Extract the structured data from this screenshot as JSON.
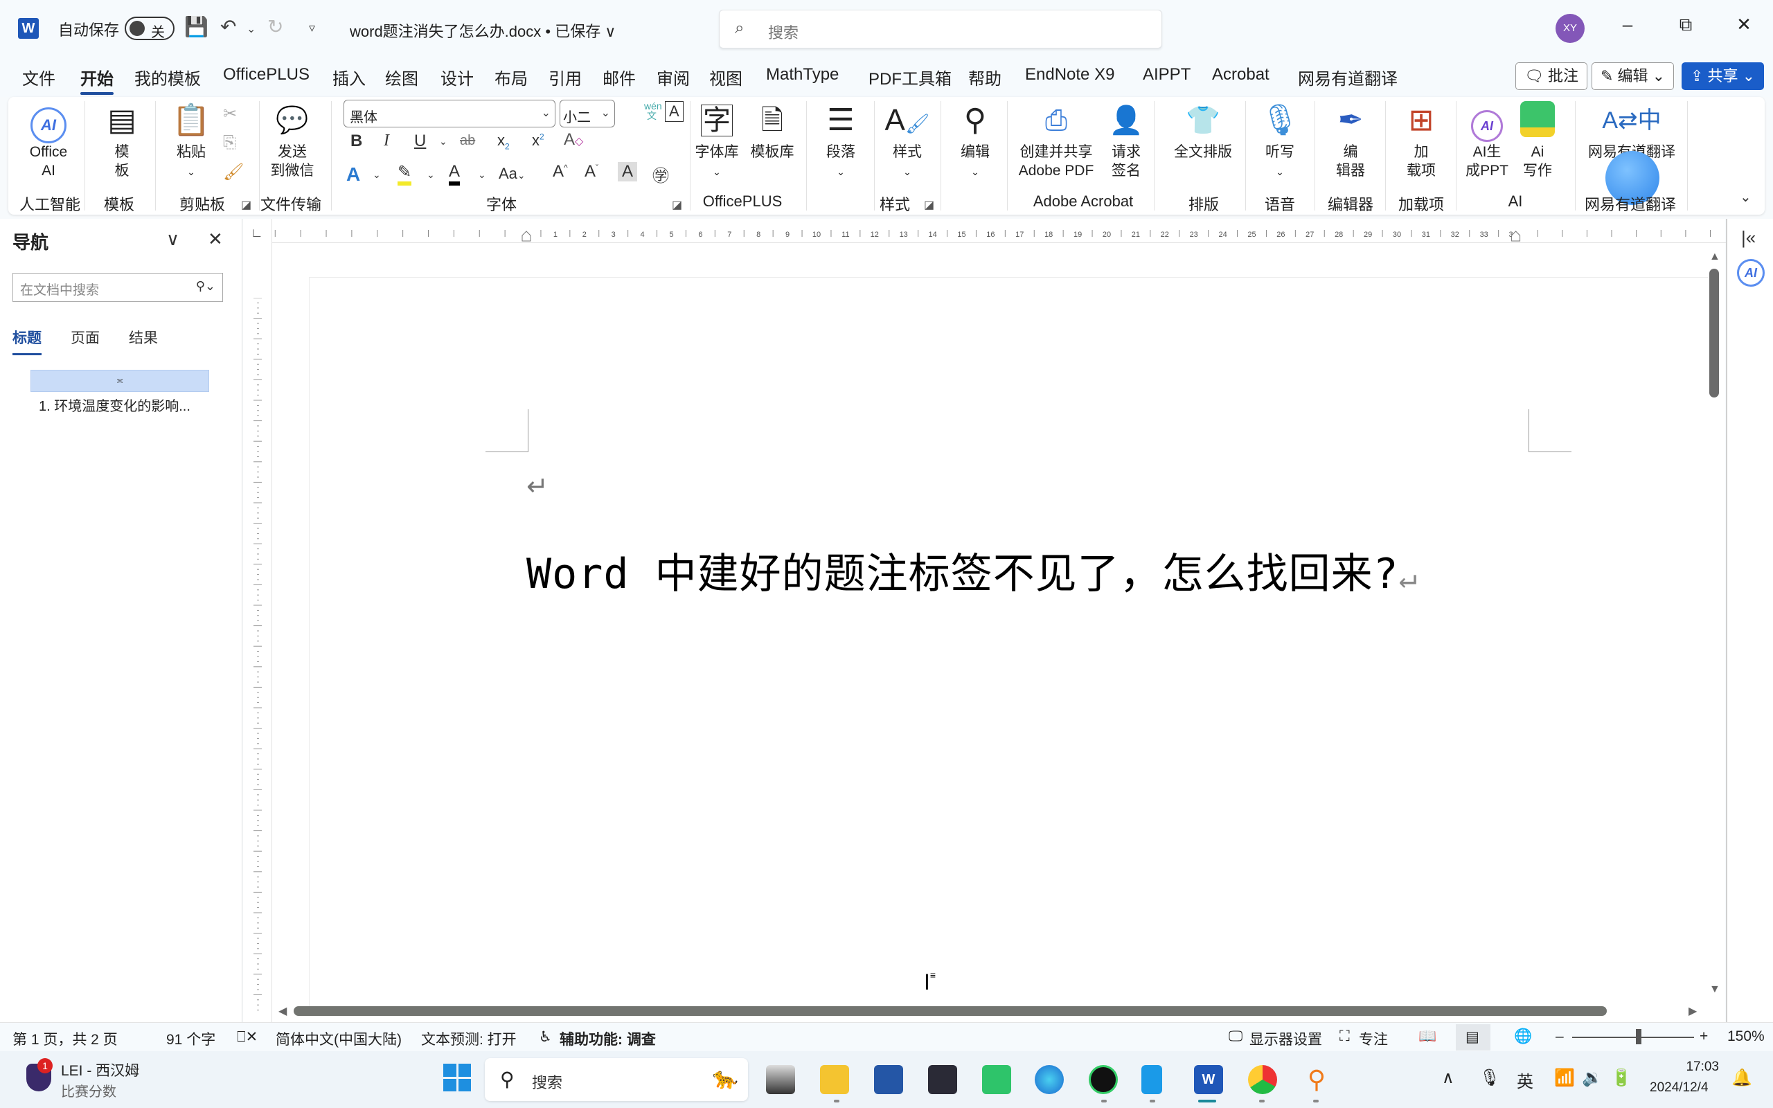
{
  "titlebar": {
    "app_icon": "word-icon",
    "autosave_label": "自动保存",
    "autosave_state": "关",
    "doc_title": "word题注消失了怎么办.docx • 已保存 ∨",
    "search_placeholder": "搜索",
    "avatar_initials": "XY",
    "minimize": "–",
    "restore": "⧉",
    "close": "✕"
  },
  "menu": {
    "tabs": [
      "文件",
      "开始",
      "我的模板",
      "OfficePLUS",
      "插入",
      "绘图",
      "设计",
      "布局",
      "引用",
      "邮件",
      "审阅",
      "视图",
      "MathType",
      "PDF工具箱",
      "帮助",
      "EndNote X9",
      "AIPPT",
      "Acrobat",
      "网易有道翻译"
    ],
    "active_tab": "开始",
    "comment_btn": "批注",
    "edit_btn": "编辑",
    "share_btn": "共享"
  },
  "ribbon": {
    "groups": {
      "ai": "人工智能",
      "template": "模板",
      "clipboard": "剪贴板",
      "transfer": "文件传输",
      "font": "字体",
      "officeplus": "OfficePLUS",
      "styles": "样式",
      "acrobat": "Adobe Acrobat",
      "layout": "排版",
      "voice": "语音",
      "editor": "编辑器",
      "addins": "加载项",
      "ai2": "AI",
      "youdao": "网易有道翻译"
    },
    "buttons": {
      "office_ai": "Office\nAI",
      "template": "模\n板",
      "paste": "粘贴",
      "send_wechat": "发送\n到微信",
      "font_lib": "字体库",
      "template_lib": "模板库",
      "paragraph": "段落",
      "styles": "样式",
      "editing": "编辑",
      "create_pdf": "创建并共享\nAdobe PDF",
      "request_sign": "请求\n签名",
      "full_layout": "全文排版",
      "dictate": "听写",
      "editor": "编\n辑器",
      "addins": "加\n载项",
      "ai_ppt": "AI生\n成PPT",
      "ai_write": "Ai\n写作",
      "youdao": "网易有道翻译"
    },
    "font_name": "黑体",
    "font_size": "小二",
    "phonetic_guide": "wén 文"
  },
  "nav": {
    "title": "导航",
    "search_placeholder": "在文档中搜索",
    "tabs": [
      "标题",
      "页面",
      "结果"
    ],
    "active_tab": "标题",
    "headings": [
      "1. 环境温度变化的影响..."
    ]
  },
  "ruler": {
    "numbers": [
      "1",
      "2",
      "3",
      "4",
      "5",
      "6",
      "7",
      "8",
      "9",
      "10",
      "11",
      "12",
      "13",
      "14",
      "15",
      "16",
      "17",
      "18",
      "19",
      "20",
      "21",
      "22",
      "23",
      "24",
      "25",
      "26",
      "27",
      "28",
      "29",
      "30",
      "31",
      "32",
      "33",
      "34"
    ]
  },
  "document": {
    "paragraph_mark": "↵",
    "heading": "Word 中建好的题注标签不见了，怎么找回来?"
  },
  "statusbar": {
    "page": "第 1 页，共 2 页",
    "words": "91 个字",
    "language": "简体中文(中国大陆)",
    "text_prediction": "文本预测: 打开",
    "accessibility": "辅助功能: 调查",
    "display_settings": "显示器设置",
    "focus": "专注",
    "zoom_level": "150%",
    "zoom_fraction": 0.5
  },
  "taskbar": {
    "widget_title": "LEI - 西汉姆",
    "widget_subtitle": "比赛分数",
    "widget_badge": "1",
    "search_placeholder": "搜索",
    "ime": "英",
    "time": "17:03",
    "date": "2024/12/4"
  },
  "colors": {
    "accent": "#1f4e9e",
    "share_button": "#1a5dc9",
    "avatar": "#8357b8",
    "nav_highlight": "#c9dcf8"
  }
}
